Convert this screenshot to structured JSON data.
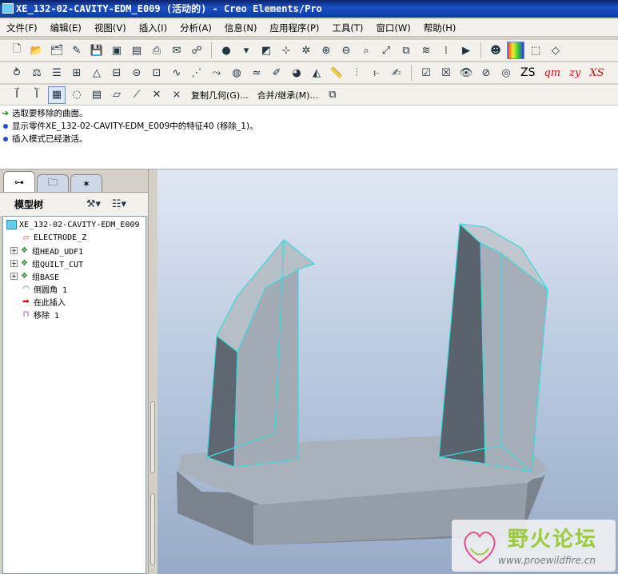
{
  "window": {
    "title": "XE_132-02-CAVITY-EDM_E009 (活动的) - Creo Elements/Pro"
  },
  "menu": [
    "文件(F)",
    "编辑(E)",
    "视图(V)",
    "插入(I)",
    "分析(A)",
    "信息(N)",
    "应用程序(P)",
    "工具(T)",
    "窗口(W)",
    "帮助(H)"
  ],
  "toolbar3": {
    "copy_geom": "复制几何(G)...",
    "merge_inherit": "合并/继承(M)...",
    "zs": "ZS",
    "qm": "qm",
    "zy": "zy",
    "xs": "XS"
  },
  "messages": [
    "选取要移除的曲面。",
    "显示零件XE_132-02-CAVITY-EDM_E009中的特征40 (移除_1)。",
    "插入模式已经激活。"
  ],
  "model_tree": {
    "title": "模型树",
    "nodes": [
      {
        "label": "XE_132-02-CAVITY-EDM_E009"
      },
      {
        "label": "ELECTRODE_Z"
      },
      {
        "label": "组HEAD_UDF1"
      },
      {
        "label": "组QUILT_CUT"
      },
      {
        "label": "组BASE"
      },
      {
        "label": "倒圆角 1"
      },
      {
        "label": "在此插入"
      },
      {
        "label": "移除 1"
      }
    ]
  },
  "watermark": {
    "title": "野火论坛",
    "url": "www.proewildfire.cn"
  },
  "colors": {
    "edge_highlight": "#3fd8e0",
    "model_gray": "#a9b1ba",
    "title_blue": "#0a246a"
  }
}
